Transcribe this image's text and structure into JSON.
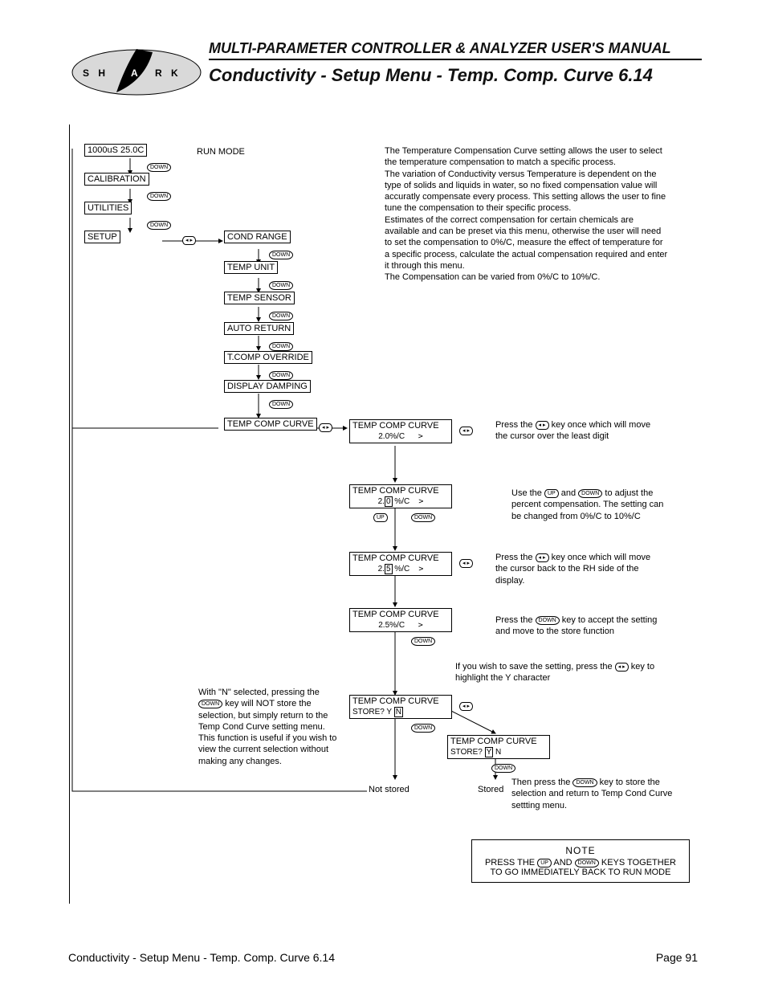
{
  "header": {
    "manual_title": "MULTI-PARAMETER CONTROLLER & ANALYZER USER'S MANUAL",
    "section_title": "Conductivity - Setup Menu - Temp. Comp. Curve 6.14",
    "logo_letters": "S H A R K"
  },
  "menus": {
    "run_mode_value": "1000uS  25.0C",
    "run_mode_label": "RUN MODE",
    "calibration": "CALIBRATION",
    "utilities": "UTILITIES",
    "setup": "SETUP",
    "cond_range": "COND RANGE",
    "temp_unit": "TEMP UNIT",
    "temp_sensor": "TEMP SENSOR",
    "auto_return": "AUTO RETURN",
    "tcomp_override": "T.COMP OVERRIDE",
    "display_damping": "DISPLAY DAMPING",
    "temp_comp_curve": "TEMP COMP CURVE"
  },
  "screens": {
    "s1_title": "TEMP COMP CURVE",
    "s1_val": "2.0%/C",
    "s2_title": "TEMP COMP CURVE",
    "s2_val_pre": "2.",
    "s2_val_hl": "0",
    "s2_val_post": " %/C",
    "s3_title": "TEMP COMP CURVE",
    "s3_val_pre": "2.",
    "s3_val_hl": "5",
    "s3_val_post": " %/C",
    "s4_title": "TEMP COMP CURVE",
    "s4_val": "2.5%/C",
    "store1_title": "TEMP COMP CURVE",
    "store1_line": "STORE?            Y",
    "store1_hl": "N",
    "store2_title": "TEMP COMP CURVE",
    "store2_line_pre": "STORE?            ",
    "store2_hl": "Y",
    "store2_line_post": "  N",
    "not_stored": "Not stored",
    "stored": "Stored"
  },
  "descriptions": {
    "main": "The Temperature Compensation Curve setting allows the user to select the temperature compensation to match a specific process.\nThe variation of Conductivity versus Temperature is dependent on the type of solids and liquids in water, so no fixed compensation value will accuratly compensate every process. This setting allows the user to fine tune the compensation to their specific process.\nEstimates of the correct compensation for certain chemicals are available and can be preset via this menu, otherwise the user will need to set the compensation to 0%/C, measure the effect of temperature for a specific process, calculate the actual compensation required and enter it through this menu.\nThe Compensation can be varied from 0%/C to 10%/C.",
    "d1_a": "Press the ",
    "d1_b": " key once which will move the cursor over the least digit",
    "d2_a": "Use the ",
    "d2_b": " and ",
    "d2_c": " to adjust the percent compensation. The setting can be changed from 0%/C to 10%/C",
    "d3_a": "Press the ",
    "d3_b": " key once which will move the cursor back to the RH side of the display.",
    "d4_a": "Press the ",
    "d4_b": " key to accept the setting and move to the store function",
    "d5_a": "If you wish to save the setting, press the ",
    "d5_b": " key to highlight the Y character",
    "n_note_a": "With \"N\" selected, pressing the ",
    "n_note_b": " key will NOT store the selection, but simply return to the Temp Cond Curve setting menu. This function is useful if you wish to view the current selection without making any changes.",
    "d6_a": "Then press the ",
    "d6_b": " key to store the selection and return to Temp Cond Curve settting menu."
  },
  "note": {
    "title": "NOTE",
    "line_a": "PRESS THE ",
    "line_b": " AND ",
    "line_c": " KEYS TOGETHER TO GO IMMEDIATELY BACK TO RUN MODE"
  },
  "footer": {
    "left": "Conductivity - Setup Menu - Temp. Comp. Curve 6.14",
    "right": "Page 91"
  }
}
